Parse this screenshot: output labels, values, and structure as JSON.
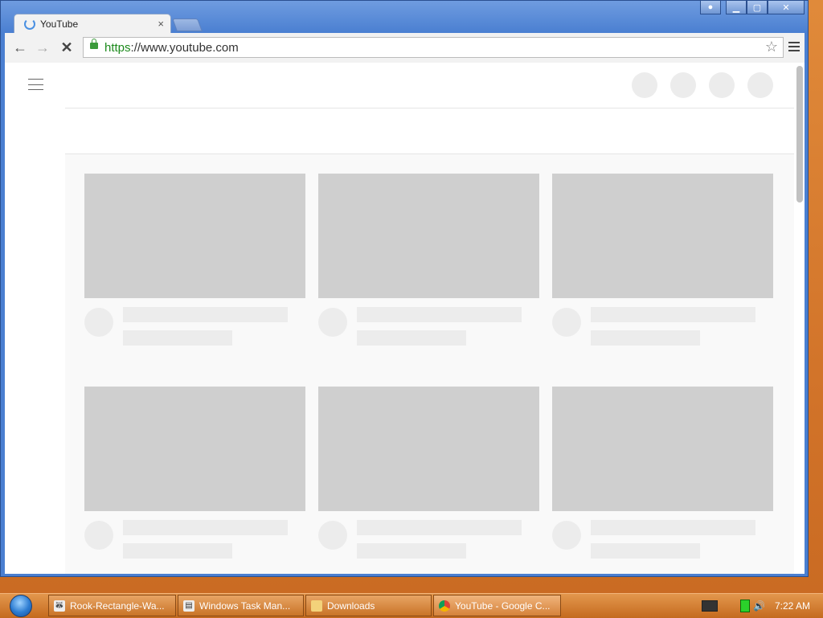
{
  "browser": {
    "tab": {
      "title": "YouTube",
      "close": "×"
    },
    "url": {
      "scheme": "https",
      "rest": "://www.youtube.com"
    },
    "icons": {
      "back": "back-arrow-icon",
      "forward": "forward-arrow-icon",
      "stop": "stop-icon",
      "bookmark": "star-icon",
      "menu": "menu-icon",
      "lock": "lock-icon"
    },
    "window_controls": {
      "user": "user-icon",
      "minimize": "minimize-icon",
      "maximize": "maximize-icon",
      "close": "close-icon"
    }
  },
  "page": {
    "header_circle_count": 4,
    "video_card_count": 6
  },
  "taskbar": {
    "items": [
      {
        "label": "Rook-Rectangle-Wa...",
        "icon": "raccoon-icon"
      },
      {
        "label": "Windows Task Man...",
        "icon": "task-manager-icon"
      },
      {
        "label": "Downloads",
        "icon": "folder-icon"
      },
      {
        "label": "YouTube - Google C...",
        "icon": "chrome-icon"
      }
    ],
    "clock": "7:22 AM"
  },
  "colors": {
    "window_frame": "#4a7fd1",
    "placeholder_thumb": "#cfcfcf",
    "placeholder_text": "#ececec",
    "taskbar": "#c97428",
    "secure_green": "#1c8a1c"
  }
}
